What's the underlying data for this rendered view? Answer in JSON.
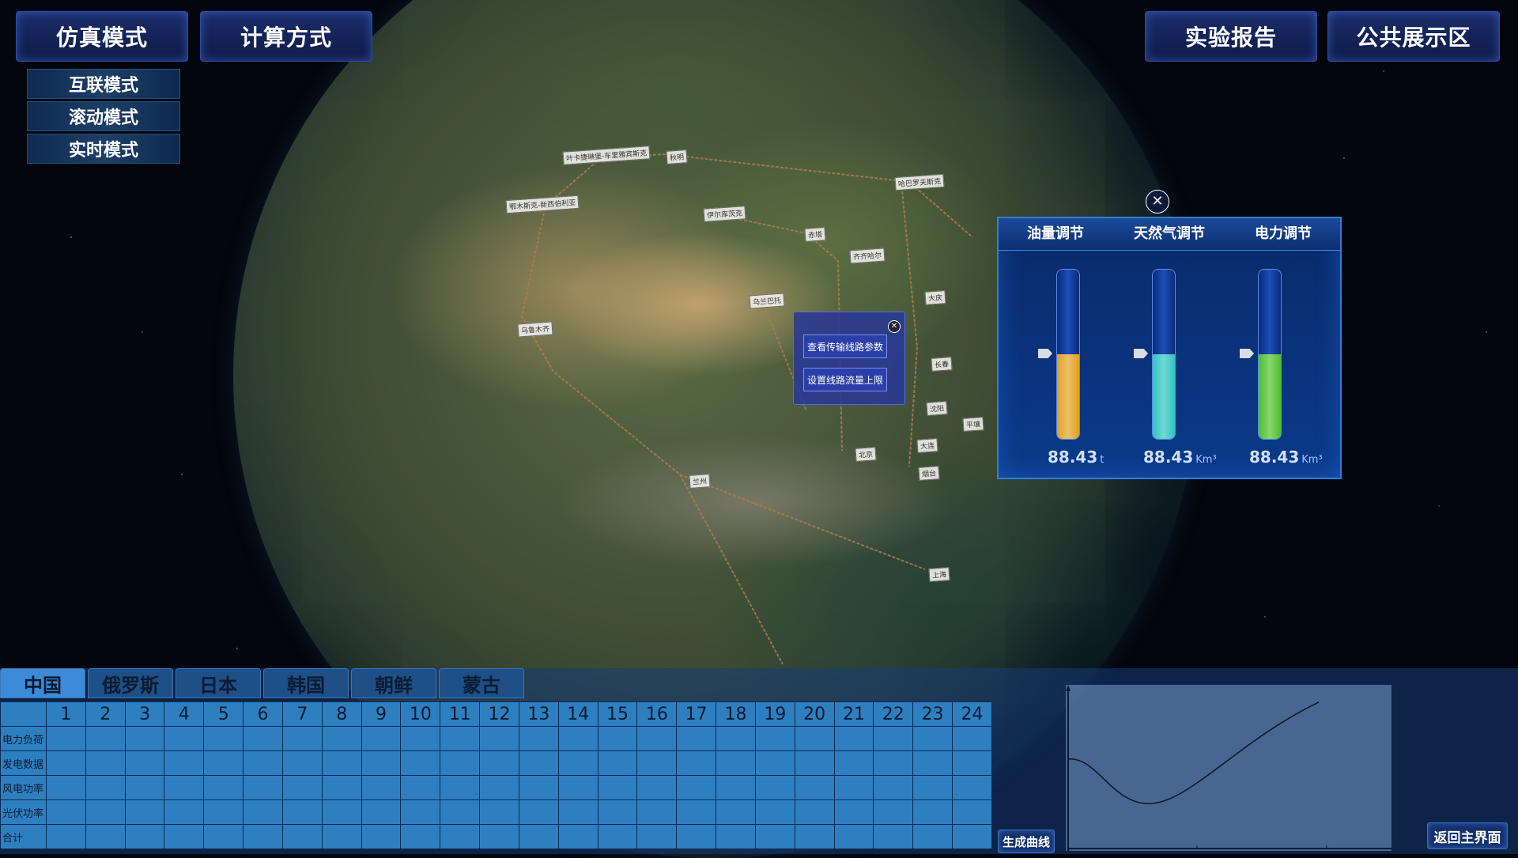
{
  "top_left_buttons": {
    "simulation": "仿真模式",
    "calculation": "计算方式"
  },
  "top_right_buttons": {
    "report": "实验报告",
    "public": "公共展示区"
  },
  "mode_buttons": [
    "互联模式",
    "滚动模式",
    "实时模式"
  ],
  "map_labels": [
    "叶卡捷琳堡-车里雅宾斯克",
    "秋明",
    "鄂木斯克-新西伯利亚",
    "伊尔库茨克",
    "赤塔",
    "哈巴罗夫斯克",
    "齐齐哈尔",
    "乌兰巴托",
    "乌鲁木齐",
    "大庆",
    "长春",
    "沈阳",
    "平壤",
    "大连",
    "北京",
    "烟台",
    "兰州",
    "上海"
  ],
  "context_menu": {
    "view_params": "查看传输线路参数",
    "set_limit": "设置线路流量上限"
  },
  "control_panel": {
    "headers": [
      "油量调节",
      "天然气调节",
      "电力调节"
    ],
    "gauges": [
      {
        "value": "88.43",
        "unit": "t",
        "level": 0.5,
        "color": "#e2a020"
      },
      {
        "value": "88.43",
        "unit": "Km³",
        "level": 0.5,
        "color": "#2fc4c0"
      },
      {
        "value": "88.43",
        "unit": "Km³",
        "level": 0.5,
        "color": "#4cc02a"
      }
    ]
  },
  "country_tabs": [
    "中国",
    "俄罗斯",
    "日本",
    "韩国",
    "朝鲜",
    "蒙古"
  ],
  "table": {
    "columns": [
      "1",
      "2",
      "3",
      "4",
      "5",
      "6",
      "7",
      "8",
      "9",
      "10",
      "11",
      "12",
      "13",
      "14",
      "15",
      "16",
      "17",
      "18",
      "19",
      "20",
      "21",
      "22",
      "23",
      "24"
    ],
    "rows": [
      "电力负荷",
      "发电数据",
      "风电功率",
      "光伏功率",
      "合计"
    ]
  },
  "generate_curve": "生成曲线",
  "return_main": "返回主界面"
}
